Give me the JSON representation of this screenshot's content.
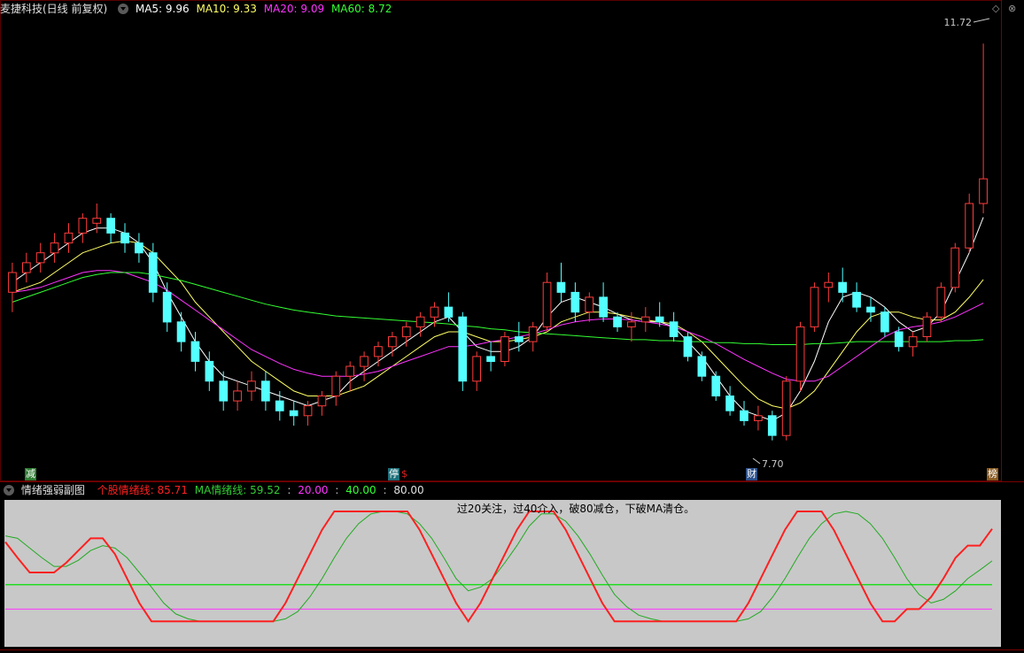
{
  "header": {
    "stock": "麦捷科技(日线 前复权)",
    "ma5": "MA5: 9.96",
    "ma10": "MA10: 9.33",
    "ma20": "MA20: 9.09",
    "ma60": "MA60: 8.72"
  },
  "annotations": {
    "high_label": "11.72",
    "low_label": "7.70",
    "note": "过20关注，过40介入，破80减仓，下破MA清仓。"
  },
  "markers": [
    {
      "text": "减",
      "color": "#2e7d32"
    },
    {
      "text": "停",
      "color": "#1f6f7a"
    },
    {
      "text": "$",
      "color": "#e02020"
    },
    {
      "text": "财",
      "color": "#2c4f8a"
    },
    {
      "text": "榜",
      "color": "#8a5a20"
    }
  ],
  "subchart": {
    "title": "情绪强弱副图",
    "line1": "个股情绪线: 85.71",
    "line2": "MA情绪线: 59.52",
    "l20": "20.00",
    "l40": "40.00",
    "l80": "80.00"
  },
  "colors": {
    "up": "#ff3c3c",
    "down": "#54ffff",
    "ma5": "#ffffff",
    "ma10": "#ffff66",
    "ma20": "#ff33ff",
    "ma60": "#33ff33",
    "sentiment": "#ff2020",
    "sentiment_ma": "#22aa22",
    "sub_bg": "#c8c8c8"
  },
  "chart_data": [
    {
      "type": "candlestick",
      "title": "麦捷科技(日线 前复权)",
      "ylim": [
        7.5,
        12.0
      ],
      "candles": [
        [
          9.2,
          9.5,
          9.0,
          9.4
        ],
        [
          9.4,
          9.6,
          9.3,
          9.5
        ],
        [
          9.5,
          9.7,
          9.4,
          9.6
        ],
        [
          9.6,
          9.8,
          9.5,
          9.7
        ],
        [
          9.7,
          9.9,
          9.6,
          9.8
        ],
        [
          9.8,
          10.0,
          9.7,
          9.95
        ],
        [
          9.9,
          10.1,
          9.8,
          9.95
        ],
        [
          9.95,
          10.0,
          9.7,
          9.8
        ],
        [
          9.8,
          9.9,
          9.6,
          9.7
        ],
        [
          9.7,
          9.8,
          9.5,
          9.6
        ],
        [
          9.6,
          9.7,
          9.1,
          9.2
        ],
        [
          9.2,
          9.3,
          8.8,
          8.9
        ],
        [
          8.9,
          9.0,
          8.6,
          8.7
        ],
        [
          8.7,
          8.8,
          8.4,
          8.5
        ],
        [
          8.5,
          8.6,
          8.2,
          8.3
        ],
        [
          8.3,
          8.4,
          8.0,
          8.1
        ],
        [
          8.1,
          8.3,
          8.0,
          8.2
        ],
        [
          8.2,
          8.4,
          8.1,
          8.3
        ],
        [
          8.3,
          8.4,
          8.0,
          8.1
        ],
        [
          8.1,
          8.2,
          7.9,
          8.0
        ],
        [
          8.0,
          8.1,
          7.85,
          7.95
        ],
        [
          7.95,
          8.1,
          7.85,
          8.05
        ],
        [
          8.05,
          8.2,
          7.95,
          8.15
        ],
        [
          8.15,
          8.4,
          8.05,
          8.35
        ],
        [
          8.35,
          8.5,
          8.2,
          8.45
        ],
        [
          8.45,
          8.6,
          8.3,
          8.55
        ],
        [
          8.55,
          8.7,
          8.45,
          8.65
        ],
        [
          8.65,
          8.8,
          8.55,
          8.75
        ],
        [
          8.75,
          8.9,
          8.65,
          8.85
        ],
        [
          8.85,
          9.0,
          8.75,
          8.95
        ],
        [
          8.95,
          9.1,
          8.85,
          9.05
        ],
        [
          9.05,
          9.2,
          8.9,
          8.95
        ],
        [
          8.95,
          9.0,
          8.2,
          8.3
        ],
        [
          8.3,
          8.6,
          8.2,
          8.55
        ],
        [
          8.55,
          8.7,
          8.4,
          8.5
        ],
        [
          8.5,
          8.8,
          8.45,
          8.75
        ],
        [
          8.75,
          8.9,
          8.6,
          8.7
        ],
        [
          8.7,
          8.9,
          8.6,
          8.85
        ],
        [
          8.85,
          9.4,
          8.8,
          9.3
        ],
        [
          9.3,
          9.5,
          9.1,
          9.2
        ],
        [
          9.2,
          9.3,
          8.9,
          9.0
        ],
        [
          9.0,
          9.2,
          8.9,
          9.15
        ],
        [
          9.15,
          9.3,
          8.9,
          8.95
        ],
        [
          8.95,
          9.0,
          8.8,
          8.85
        ],
        [
          8.85,
          9.0,
          8.7,
          8.9
        ],
        [
          8.9,
          9.05,
          8.8,
          8.95
        ],
        [
          8.95,
          9.1,
          8.85,
          8.9
        ],
        [
          8.9,
          9.0,
          8.7,
          8.75
        ],
        [
          8.75,
          8.8,
          8.5,
          8.55
        ],
        [
          8.55,
          8.6,
          8.3,
          8.35
        ],
        [
          8.35,
          8.4,
          8.1,
          8.15
        ],
        [
          8.15,
          8.25,
          7.95,
          8.0
        ],
        [
          8.0,
          8.1,
          7.85,
          7.9
        ],
        [
          7.9,
          8.05,
          7.8,
          7.95
        ],
        [
          7.95,
          8.0,
          7.7,
          7.75
        ],
        [
          7.75,
          8.35,
          7.7,
          8.3
        ],
        [
          8.3,
          8.9,
          8.2,
          8.85
        ],
        [
          8.85,
          9.3,
          8.8,
          9.25
        ],
        [
          9.25,
          9.4,
          9.1,
          9.3
        ],
        [
          9.3,
          9.45,
          9.1,
          9.2
        ],
        [
          9.2,
          9.3,
          9.0,
          9.05
        ],
        [
          9.05,
          9.15,
          8.9,
          9.0
        ],
        [
          9.0,
          9.05,
          8.75,
          8.8
        ],
        [
          8.8,
          8.85,
          8.6,
          8.65
        ],
        [
          8.65,
          8.8,
          8.55,
          8.75
        ],
        [
          8.75,
          9.0,
          8.7,
          8.95
        ],
        [
          8.95,
          9.3,
          8.9,
          9.25
        ],
        [
          9.25,
          9.7,
          9.2,
          9.65
        ],
        [
          9.65,
          10.2,
          9.6,
          10.1
        ],
        [
          10.1,
          11.72,
          10.0,
          10.35
        ]
      ],
      "series": [
        {
          "name": "MA5",
          "values": [
            9.3,
            9.4,
            9.5,
            9.6,
            9.7,
            9.8,
            9.85,
            9.85,
            9.8,
            9.7,
            9.5,
            9.2,
            8.95,
            8.7,
            8.5,
            8.35,
            8.3,
            8.25,
            8.2,
            8.15,
            8.1,
            8.05,
            8.1,
            8.15,
            8.3,
            8.4,
            8.5,
            8.6,
            8.7,
            8.8,
            8.9,
            8.95,
            8.8,
            8.65,
            8.6,
            8.6,
            8.65,
            8.75,
            8.95,
            9.1,
            9.15,
            9.1,
            9.05,
            8.98,
            8.92,
            8.9,
            8.9,
            8.85,
            8.7,
            8.55,
            8.35,
            8.15,
            8.0,
            7.95,
            7.9,
            7.98,
            8.2,
            8.5,
            8.9,
            9.15,
            9.2,
            9.15,
            9.05,
            8.9,
            8.8,
            8.85,
            9.0,
            9.3,
            9.6,
            9.96
          ]
        },
        {
          "name": "MA10",
          "values": [
            9.2,
            9.25,
            9.3,
            9.4,
            9.5,
            9.6,
            9.65,
            9.7,
            9.72,
            9.7,
            9.6,
            9.45,
            9.3,
            9.1,
            8.95,
            8.8,
            8.65,
            8.5,
            8.4,
            8.3,
            8.2,
            8.15,
            8.15,
            8.15,
            8.2,
            8.25,
            8.35,
            8.45,
            8.55,
            8.65,
            8.75,
            8.8,
            8.8,
            8.75,
            8.7,
            8.7,
            8.72,
            8.75,
            8.8,
            8.9,
            8.95,
            9.0,
            9.0,
            8.98,
            8.95,
            8.92,
            8.9,
            8.88,
            8.8,
            8.7,
            8.55,
            8.4,
            8.25,
            8.12,
            8.05,
            8.02,
            8.08,
            8.2,
            8.4,
            8.6,
            8.8,
            8.95,
            9.0,
            9.0,
            8.95,
            8.92,
            8.92,
            9.0,
            9.15,
            9.33
          ]
        },
        {
          "name": "MA20",
          "values": [
            9.2,
            9.22,
            9.25,
            9.3,
            9.35,
            9.4,
            9.42,
            9.42,
            9.4,
            9.35,
            9.3,
            9.22,
            9.12,
            9.02,
            8.92,
            8.82,
            8.72,
            8.62,
            8.55,
            8.48,
            8.42,
            8.38,
            8.35,
            8.35,
            8.35,
            8.37,
            8.4,
            8.45,
            8.5,
            8.55,
            8.6,
            8.65,
            8.65,
            8.67,
            8.7,
            8.72,
            8.75,
            8.78,
            8.82,
            8.87,
            8.9,
            8.92,
            8.93,
            8.93,
            8.92,
            8.9,
            8.88,
            8.85,
            8.8,
            8.75,
            8.68,
            8.6,
            8.52,
            8.45,
            8.38,
            8.32,
            8.3,
            8.3,
            8.35,
            8.45,
            8.55,
            8.65,
            8.75,
            8.82,
            8.85,
            8.87,
            8.9,
            8.95,
            9.02,
            9.09
          ]
        },
        {
          "name": "MA60",
          "values": [
            9.1,
            9.15,
            9.2,
            9.25,
            9.3,
            9.35,
            9.38,
            9.4,
            9.4,
            9.4,
            9.38,
            9.35,
            9.32,
            9.28,
            9.24,
            9.2,
            9.16,
            9.12,
            9.08,
            9.05,
            9.02,
            9.0,
            8.98,
            8.96,
            8.95,
            8.94,
            8.93,
            8.92,
            8.91,
            8.9,
            8.89,
            8.88,
            8.86,
            8.85,
            8.83,
            8.82,
            8.8,
            8.79,
            8.78,
            8.77,
            8.76,
            8.75,
            8.74,
            8.73,
            8.72,
            8.72,
            8.71,
            8.71,
            8.7,
            8.7,
            8.69,
            8.69,
            8.68,
            8.68,
            8.67,
            8.67,
            8.67,
            8.68,
            8.68,
            8.69,
            8.7,
            8.7,
            8.7,
            8.7,
            8.7,
            8.7,
            8.7,
            8.71,
            8.71,
            8.72
          ]
        }
      ]
    },
    {
      "type": "line",
      "title": "情绪强弱副图",
      "ylim": [
        0,
        100
      ],
      "reference_lines": [
        20,
        40,
        80
      ],
      "series": [
        {
          "name": "个股情绪线",
          "values": [
            75,
            62,
            50,
            50,
            50,
            58,
            68,
            78,
            78,
            65,
            45,
            25,
            10,
            10,
            10,
            10,
            10,
            10,
            10,
            10,
            10,
            10,
            10,
            25,
            45,
            65,
            85,
            100,
            100,
            100,
            100,
            100,
            100,
            100,
            85,
            65,
            45,
            25,
            10,
            25,
            45,
            65,
            85,
            100,
            100,
            100,
            85,
            65,
            45,
            25,
            10,
            10,
            10,
            10,
            10,
            10,
            10,
            10,
            10,
            10,
            10,
            25,
            45,
            65,
            85,
            100,
            100,
            100,
            85,
            65,
            45,
            25,
            10,
            10,
            20,
            20,
            30,
            45,
            62,
            72,
            72,
            85.71
          ]
        },
        {
          "name": "MA情绪线",
          "values": [
            80,
            78,
            70,
            62,
            55,
            55,
            60,
            68,
            72,
            70,
            62,
            50,
            38,
            25,
            16,
            12,
            10,
            10,
            10,
            10,
            10,
            10,
            10,
            12,
            18,
            30,
            45,
            62,
            78,
            90,
            98,
            100,
            100,
            98,
            90,
            78,
            62,
            45,
            35,
            38,
            45,
            58,
            72,
            88,
            98,
            98,
            92,
            80,
            65,
            48,
            32,
            22,
            15,
            12,
            10,
            10,
            10,
            10,
            10,
            10,
            10,
            12,
            18,
            30,
            45,
            62,
            78,
            90,
            98,
            100,
            98,
            90,
            78,
            62,
            45,
            32,
            25,
            28,
            35,
            45,
            52,
            59.52
          ]
        }
      ]
    }
  ]
}
